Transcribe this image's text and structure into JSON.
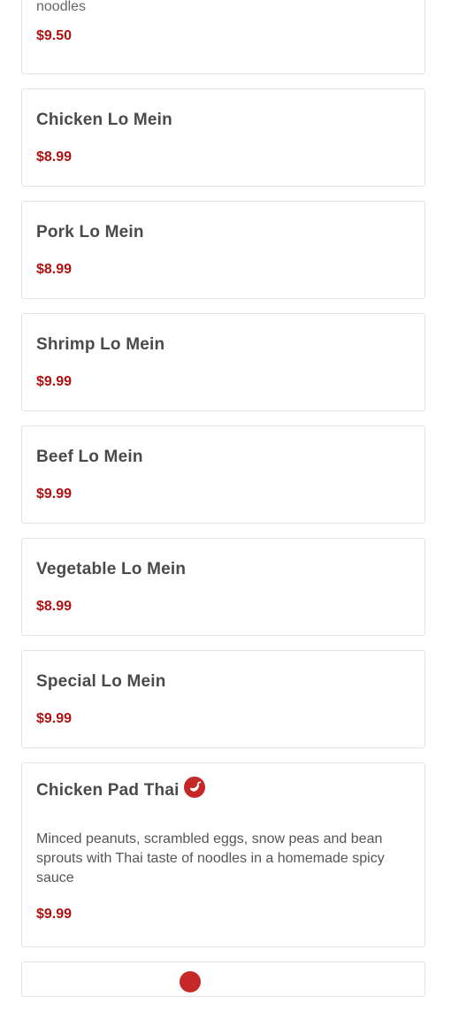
{
  "items": [
    {
      "name": "",
      "description": "noodles",
      "price": "$9.50"
    },
    {
      "name": "Chicken Lo Mein",
      "price": "$8.99"
    },
    {
      "name": "Pork Lo Mein",
      "price": "$8.99"
    },
    {
      "name": "Shrimp Lo Mein",
      "price": "$9.99"
    },
    {
      "name": "Beef Lo Mein",
      "price": "$9.99"
    },
    {
      "name": "Vegetable Lo Mein",
      "price": "$8.99"
    },
    {
      "name": "Special Lo Mein",
      "price": "$9.99"
    },
    {
      "name": "Chicken Pad Thai",
      "spicy": true,
      "description": "Minced peanuts, scrambled eggs, snow peas and bean sprouts with Thai taste of noodles in a homemade spicy sauce",
      "price": "$9.99"
    }
  ],
  "icons": {
    "spicy": "chili-pepper-icon"
  },
  "colors": {
    "price": "#b01010",
    "spicy": "#c62828",
    "border": "#e3e3e3"
  }
}
